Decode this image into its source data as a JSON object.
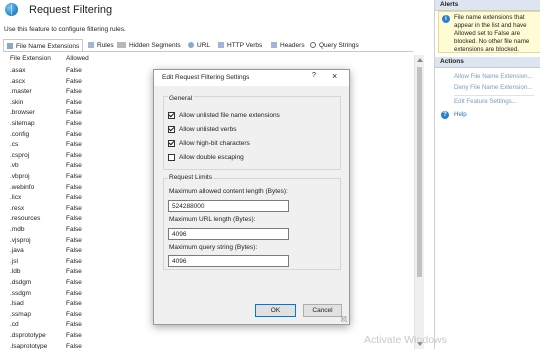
{
  "header": {
    "title": "Request Filtering",
    "description": "Use this feature to configure filtering rules."
  },
  "tabs": [
    {
      "label": "File Name Extensions",
      "icon": "file-extension-icon"
    },
    {
      "label": "Rules",
      "icon": "rules-icon"
    },
    {
      "label": "Hidden Segments",
      "icon": "hidden-segments-icon"
    },
    {
      "label": "URL",
      "icon": "url-icon"
    },
    {
      "label": "HTTP Verbs",
      "icon": "http-verbs-icon"
    },
    {
      "label": "Headers",
      "icon": "headers-icon"
    },
    {
      "label": "Query Strings",
      "icon": "query-strings-icon"
    }
  ],
  "table": {
    "columns": [
      "File Extension",
      "Allowed"
    ],
    "rows": [
      [
        ".asax",
        "False"
      ],
      [
        ".ascx",
        "False"
      ],
      [
        ".master",
        "False"
      ],
      [
        ".skin",
        "False"
      ],
      [
        ".browser",
        "False"
      ],
      [
        ".sitemap",
        "False"
      ],
      [
        ".config",
        "False"
      ],
      [
        ".cs",
        "False"
      ],
      [
        ".csproj",
        "False"
      ],
      [
        ".vb",
        "False"
      ],
      [
        ".vbproj",
        "False"
      ],
      [
        ".webinfo",
        "False"
      ],
      [
        ".licx",
        "False"
      ],
      [
        ".resx",
        "False"
      ],
      [
        ".resources",
        "False"
      ],
      [
        ".mdb",
        "False"
      ],
      [
        ".vjsproj",
        "False"
      ],
      [
        ".java",
        "False"
      ],
      [
        ".jsl",
        "False"
      ],
      [
        ".ldb",
        "False"
      ],
      [
        ".dsdgm",
        "False"
      ],
      [
        ".ssdgm",
        "False"
      ],
      [
        ".lsad",
        "False"
      ],
      [
        ".ssmap",
        "False"
      ],
      [
        ".cd",
        "False"
      ],
      [
        ".dsprototype",
        "False"
      ],
      [
        ".lsaprototype",
        "False"
      ]
    ]
  },
  "actions_pane": {
    "alerts_header": "Alerts",
    "alert_text": "File name extensions that appear in the list and have Allowed set to False are blocked. No other file name extensions are blocked.",
    "actions_header": "Actions",
    "links": [
      "Allow File Name Extension...",
      "Deny File Name Extension...",
      "Edit Feature Settings..."
    ],
    "help_label": "Help"
  },
  "dialog": {
    "title": "Edit Request Filtering Settings",
    "help_glyph": "?",
    "close_glyph": "×",
    "general_label": "General",
    "checkboxes": [
      {
        "label": "Allow unlisted file name extensions",
        "checked": true
      },
      {
        "label": "Allow unlisted verbs",
        "checked": true
      },
      {
        "label": "Allow high-bit characters",
        "checked": true
      },
      {
        "label": "Allow double escaping",
        "checked": false
      }
    ],
    "limits_label": "Request Limits",
    "fields": [
      {
        "label": "Maximum allowed content length (Bytes):",
        "value": "524288000"
      },
      {
        "label": "Maximum URL length (Bytes):",
        "value": "4096"
      },
      {
        "label": "Maximum query string (Bytes):",
        "value": "4096"
      }
    ],
    "ok_label": "OK",
    "cancel_label": "Cancel"
  },
  "watermark": "Activate Windows",
  "colors": {
    "link": "#2f6fb8",
    "disabled_link": "#7a9cc0",
    "alert_bg": "#fffbd5",
    "pane_header_bg": "#dde6f0",
    "primary_button_border": "#0078d7"
  }
}
